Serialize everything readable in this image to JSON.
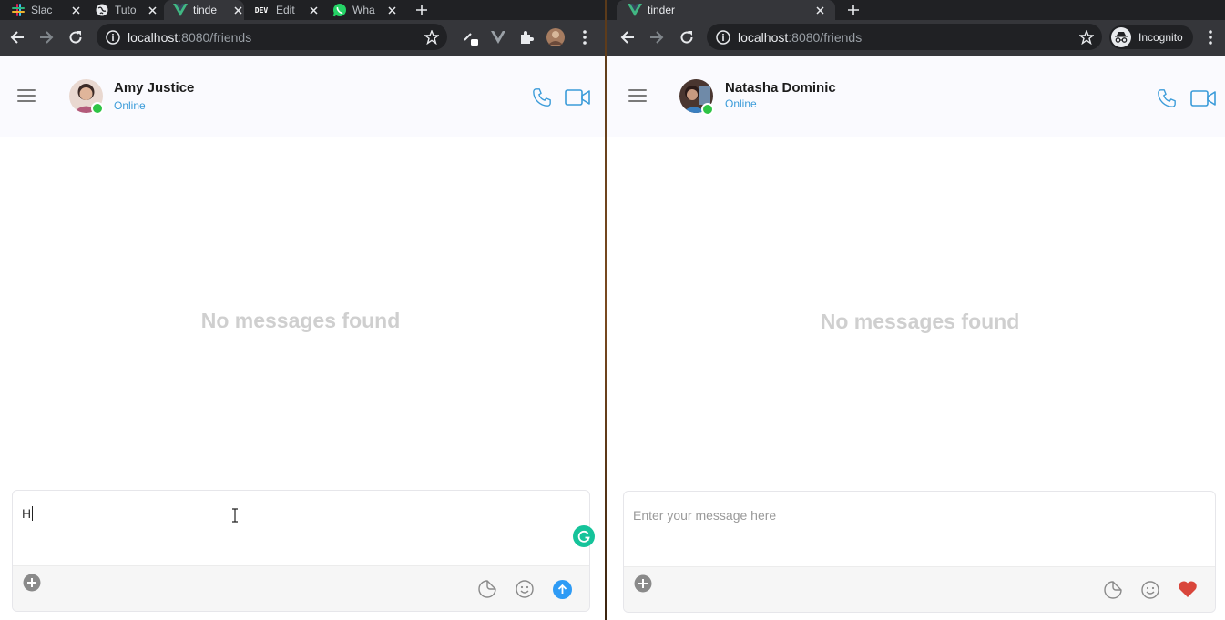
{
  "left_window": {
    "tabs": [
      {
        "title": "Slac",
        "icon": "slack-icon"
      },
      {
        "title": "Tuto",
        "icon": "globe-icon"
      },
      {
        "title": "tinde",
        "icon": "vue-icon"
      },
      {
        "title": "Edit",
        "icon": "dev-icon",
        "icon_text": "DEV"
      },
      {
        "title": "Wha",
        "icon": "whatsapp-icon"
      }
    ],
    "url_host": "localhost",
    "url_rest": ":8080/friends",
    "contact_name": "Amy Justice",
    "contact_status": "Online",
    "empty_text": "No messages found",
    "composer_text": "H"
  },
  "right_window": {
    "tabs": [
      {
        "title": "tinder",
        "icon": "vue-icon"
      }
    ],
    "url_host": "localhost",
    "url_rest": ":8080/friends",
    "incognito_label": "Incognito",
    "contact_name": "Natasha Dominic",
    "contact_status": "Online",
    "empty_text": "No messages found",
    "composer_placeholder": "Enter your message here"
  },
  "colors": {
    "accent_blue": "#3a9bd9",
    "online_green": "#2ec445",
    "heart_red": "#d9463b",
    "send_blue": "#2e9bf5",
    "grammarly_green": "#15c39a"
  }
}
